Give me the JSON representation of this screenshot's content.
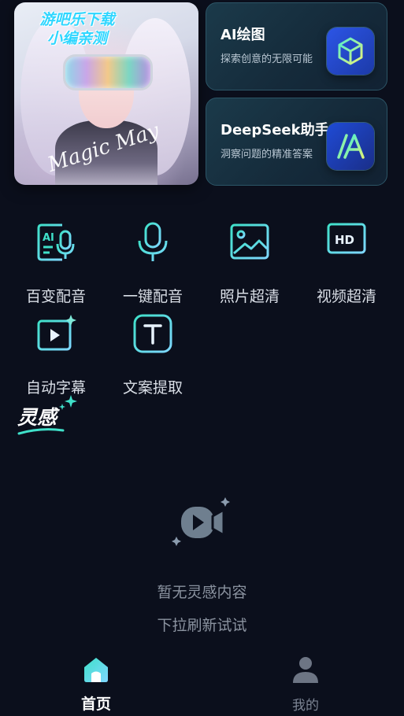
{
  "hero": {
    "watermark_line1": "游吧乐下载",
    "watermark_line2": "小编亲测",
    "signature": "Magic May"
  },
  "features": [
    {
      "title": "AI绘图",
      "subtitle": "探索创意的无限可能",
      "icon": "cube-icon"
    },
    {
      "title": "DeepSeek助手",
      "subtitle": "洞察问题的精准答案",
      "icon": "deepseek-a-icon"
    }
  ],
  "tools": [
    {
      "label": "百变配音",
      "icon": "ai-voice-icon"
    },
    {
      "label": "一键配音",
      "icon": "microphone-icon"
    },
    {
      "label": "照片超清",
      "icon": "photo-icon"
    },
    {
      "label": "视频超清",
      "icon": "hd-icon"
    },
    {
      "label": "自动字幕",
      "icon": "video-subtitle-icon"
    },
    {
      "label": "文案提取",
      "icon": "text-extract-icon"
    }
  ],
  "inspiration": {
    "title": "灵感"
  },
  "empty": {
    "line1": "暂无灵感内容",
    "line2": "下拉刷新试试"
  },
  "nav": {
    "home": "首页",
    "mine": "我的"
  },
  "colors": {
    "background": "#0b0f1c",
    "accent_teal": "#3fe0c9",
    "accent_blue": "#2c55e6"
  }
}
